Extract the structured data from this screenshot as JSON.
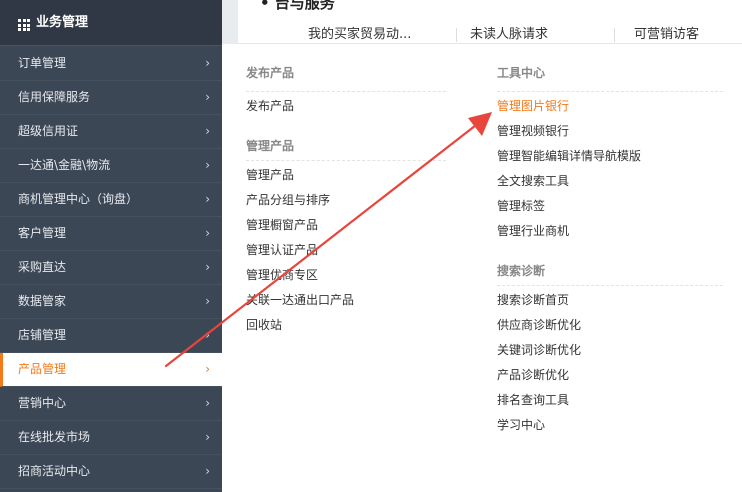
{
  "topbar": {
    "heading": "• 台与服务",
    "tabs": [
      "我的买家贸易动...",
      "未读人脉请求",
      "可营销访客"
    ]
  },
  "sidebar": {
    "title": "业务管理",
    "items": [
      {
        "label": "订单管理"
      },
      {
        "label": "信用保障服务"
      },
      {
        "label": "超级信用证"
      },
      {
        "label": "一达通\\金融\\物流"
      },
      {
        "label": "商机管理中心（询盘）"
      },
      {
        "label": "客户管理"
      },
      {
        "label": "采购直达"
      },
      {
        "label": "数据管家"
      },
      {
        "label": "店铺管理"
      },
      {
        "label": "产品管理",
        "active": true
      },
      {
        "label": "营销中心"
      },
      {
        "label": "在线批发市场"
      },
      {
        "label": "招商活动中心"
      }
    ]
  },
  "panel": {
    "col1": {
      "groups": [
        {
          "title": "发布产品",
          "links": [
            "发布产品"
          ]
        },
        {
          "title": "管理产品",
          "links": [
            "管理产品",
            "产品分组与排序",
            "管理橱窗产品",
            "管理认证产品",
            "管理优商专区",
            "关联一达通出口产品",
            "回收站"
          ]
        }
      ]
    },
    "col2": {
      "groups": [
        {
          "title": "工具中心",
          "links": [
            "管理图片银行",
            "管理视频银行",
            "管理智能编辑详情导航模版",
            "全文搜索工具",
            "管理标签",
            "管理行业商机"
          ]
        },
        {
          "title": "搜索诊断",
          "links": [
            "搜索诊断首页",
            "供应商诊断优化",
            "关键词诊断优化",
            "产品诊断优化",
            "排名查询工具",
            "学习中心"
          ]
        }
      ]
    }
  },
  "colors": {
    "sidebar_bg": "#3c4755",
    "accent": "#f27a1a",
    "arrow": "#e8453c"
  }
}
